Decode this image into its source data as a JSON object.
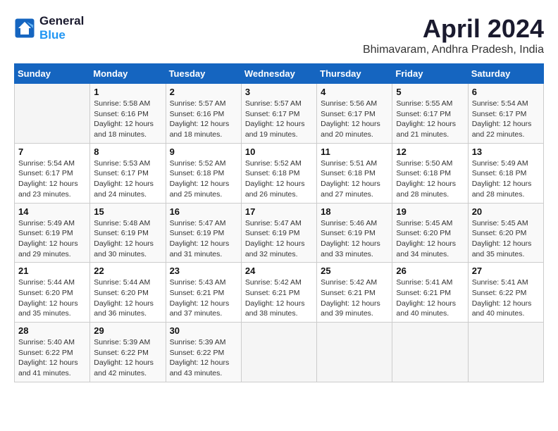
{
  "header": {
    "logo_line1": "General",
    "logo_line2": "Blue",
    "month_year": "April 2024",
    "location": "Bhimavaram, Andhra Pradesh, India"
  },
  "weekdays": [
    "Sunday",
    "Monday",
    "Tuesday",
    "Wednesday",
    "Thursday",
    "Friday",
    "Saturday"
  ],
  "weeks": [
    [
      {
        "day": null
      },
      {
        "day": "1",
        "sunrise": "5:58 AM",
        "sunset": "6:16 PM",
        "daylight": "12 hours and 18 minutes."
      },
      {
        "day": "2",
        "sunrise": "5:57 AM",
        "sunset": "6:16 PM",
        "daylight": "12 hours and 18 minutes."
      },
      {
        "day": "3",
        "sunrise": "5:57 AM",
        "sunset": "6:17 PM",
        "daylight": "12 hours and 19 minutes."
      },
      {
        "day": "4",
        "sunrise": "5:56 AM",
        "sunset": "6:17 PM",
        "daylight": "12 hours and 20 minutes."
      },
      {
        "day": "5",
        "sunrise": "5:55 AM",
        "sunset": "6:17 PM",
        "daylight": "12 hours and 21 minutes."
      },
      {
        "day": "6",
        "sunrise": "5:54 AM",
        "sunset": "6:17 PM",
        "daylight": "12 hours and 22 minutes."
      }
    ],
    [
      {
        "day": "7",
        "sunrise": "5:54 AM",
        "sunset": "6:17 PM",
        "daylight": "12 hours and 23 minutes."
      },
      {
        "day": "8",
        "sunrise": "5:53 AM",
        "sunset": "6:17 PM",
        "daylight": "12 hours and 24 minutes."
      },
      {
        "day": "9",
        "sunrise": "5:52 AM",
        "sunset": "6:18 PM",
        "daylight": "12 hours and 25 minutes."
      },
      {
        "day": "10",
        "sunrise": "5:52 AM",
        "sunset": "6:18 PM",
        "daylight": "12 hours and 26 minutes."
      },
      {
        "day": "11",
        "sunrise": "5:51 AM",
        "sunset": "6:18 PM",
        "daylight": "12 hours and 27 minutes."
      },
      {
        "day": "12",
        "sunrise": "5:50 AM",
        "sunset": "6:18 PM",
        "daylight": "12 hours and 28 minutes."
      },
      {
        "day": "13",
        "sunrise": "5:49 AM",
        "sunset": "6:18 PM",
        "daylight": "12 hours and 28 minutes."
      }
    ],
    [
      {
        "day": "14",
        "sunrise": "5:49 AM",
        "sunset": "6:19 PM",
        "daylight": "12 hours and 29 minutes."
      },
      {
        "day": "15",
        "sunrise": "5:48 AM",
        "sunset": "6:19 PM",
        "daylight": "12 hours and 30 minutes."
      },
      {
        "day": "16",
        "sunrise": "5:47 AM",
        "sunset": "6:19 PM",
        "daylight": "12 hours and 31 minutes."
      },
      {
        "day": "17",
        "sunrise": "5:47 AM",
        "sunset": "6:19 PM",
        "daylight": "12 hours and 32 minutes."
      },
      {
        "day": "18",
        "sunrise": "5:46 AM",
        "sunset": "6:19 PM",
        "daylight": "12 hours and 33 minutes."
      },
      {
        "day": "19",
        "sunrise": "5:45 AM",
        "sunset": "6:20 PM",
        "daylight": "12 hours and 34 minutes."
      },
      {
        "day": "20",
        "sunrise": "5:45 AM",
        "sunset": "6:20 PM",
        "daylight": "12 hours and 35 minutes."
      }
    ],
    [
      {
        "day": "21",
        "sunrise": "5:44 AM",
        "sunset": "6:20 PM",
        "daylight": "12 hours and 35 minutes."
      },
      {
        "day": "22",
        "sunrise": "5:44 AM",
        "sunset": "6:20 PM",
        "daylight": "12 hours and 36 minutes."
      },
      {
        "day": "23",
        "sunrise": "5:43 AM",
        "sunset": "6:21 PM",
        "daylight": "12 hours and 37 minutes."
      },
      {
        "day": "24",
        "sunrise": "5:42 AM",
        "sunset": "6:21 PM",
        "daylight": "12 hours and 38 minutes."
      },
      {
        "day": "25",
        "sunrise": "5:42 AM",
        "sunset": "6:21 PM",
        "daylight": "12 hours and 39 minutes."
      },
      {
        "day": "26",
        "sunrise": "5:41 AM",
        "sunset": "6:21 PM",
        "daylight": "12 hours and 40 minutes."
      },
      {
        "day": "27",
        "sunrise": "5:41 AM",
        "sunset": "6:22 PM",
        "daylight": "12 hours and 40 minutes."
      }
    ],
    [
      {
        "day": "28",
        "sunrise": "5:40 AM",
        "sunset": "6:22 PM",
        "daylight": "12 hours and 41 minutes."
      },
      {
        "day": "29",
        "sunrise": "5:39 AM",
        "sunset": "6:22 PM",
        "daylight": "12 hours and 42 minutes."
      },
      {
        "day": "30",
        "sunrise": "5:39 AM",
        "sunset": "6:22 PM",
        "daylight": "12 hours and 43 minutes."
      },
      {
        "day": null
      },
      {
        "day": null
      },
      {
        "day": null
      },
      {
        "day": null
      }
    ]
  ],
  "labels": {
    "sunrise_prefix": "Sunrise: ",
    "sunset_prefix": "Sunset: ",
    "daylight_prefix": "Daylight: "
  }
}
